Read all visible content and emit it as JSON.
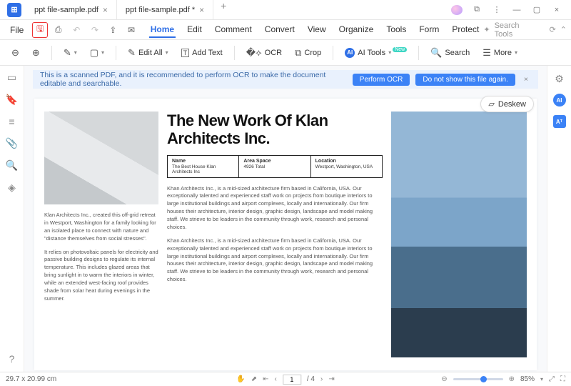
{
  "tabs": [
    {
      "label": "ppt file-sample.pdf",
      "active": false
    },
    {
      "label": "ppt file-sample.pdf *",
      "active": true
    }
  ],
  "file_label": "File",
  "menus": [
    "Home",
    "Edit",
    "Comment",
    "Convert",
    "View",
    "Organize",
    "Tools",
    "Form",
    "Protect"
  ],
  "active_menu": "Home",
  "search_tools_placeholder": "Search Tools",
  "toolbar": {
    "edit_all": "Edit All",
    "add_text": "Add Text",
    "ocr": "OCR",
    "crop": "Crop",
    "ai_tools": "AI Tools",
    "search": "Search",
    "more": "More",
    "new_badge": "New"
  },
  "ocr_bar": {
    "msg": "This is a scanned PDF, and it is recommended to perform OCR to make the document editable and searchable.",
    "perform": "Perform OCR",
    "dismiss": "Do not show this file again."
  },
  "deskew": "Deskew",
  "doc": {
    "headline": "The New Work Of Klan Architects Inc.",
    "table": [
      {
        "h": "Name",
        "v": "The Best House Klan Architects Inc"
      },
      {
        "h": "Area Space",
        "v": "4926 Total"
      },
      {
        "h": "Location",
        "v": "Westport, Washington, USA"
      }
    ],
    "left_p1": "Klan Architects Inc., created this off-grid retreat in Westport, Washington for a family looking for an isolated place to connect with nature and \"distance themselves from social stresses\".",
    "left_p2": "It relies on photovoltaic panels for electricity and passive building designs to regulate its internal temperature. This includes glazed areas that bring sunlight in to warm the interiors in winter, while an extended west-facing roof provides shade from solar heat during evenings in the summer.",
    "mid_p": "Khan Architects Inc., is a mid-sized architecture firm based in California, USA. Our exceptionally talented and experienced staff work on projects from boutique interiors to large institutional buildings and airport complexes, locally and internationally. Our firm houses their architecture, interior design, graphic design, landscape and model making staff. We strieve to be leaders in the community through work, research and personal choices."
  },
  "status": {
    "dims": "29.7 x 20.99 cm",
    "page_current": "1",
    "page_total": "/ 4",
    "zoom": "85%"
  }
}
